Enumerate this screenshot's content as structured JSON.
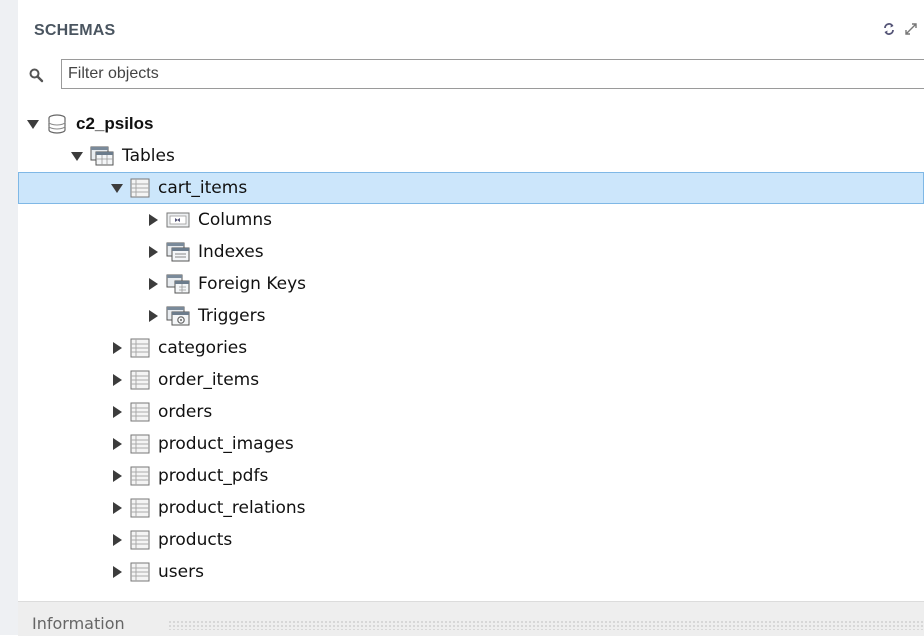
{
  "schemas": {
    "title": "SCHEMAS",
    "icons": [
      "refresh-icon",
      "expand-icon"
    ]
  },
  "filter": {
    "placeholder": "Filter objects",
    "value": ""
  },
  "tree": {
    "schema": {
      "name": "c2_psilos",
      "expanded": true
    },
    "tables_node": {
      "label": "Tables",
      "expanded": true
    },
    "selected_table": {
      "name": "cart_items",
      "expanded": true,
      "children": [
        "Columns",
        "Indexes",
        "Foreign Keys",
        "Triggers"
      ]
    },
    "other_tables": [
      "categories",
      "order_items",
      "orders",
      "product_images",
      "product_pdfs",
      "product_relations",
      "products",
      "users"
    ]
  },
  "info": {
    "label": "Information"
  },
  "colors": {
    "selection_bg": "#cce6fb",
    "selection_border": "#7fb8e6",
    "arrow": "#3c3c3c",
    "header_text": "#4a5560"
  }
}
